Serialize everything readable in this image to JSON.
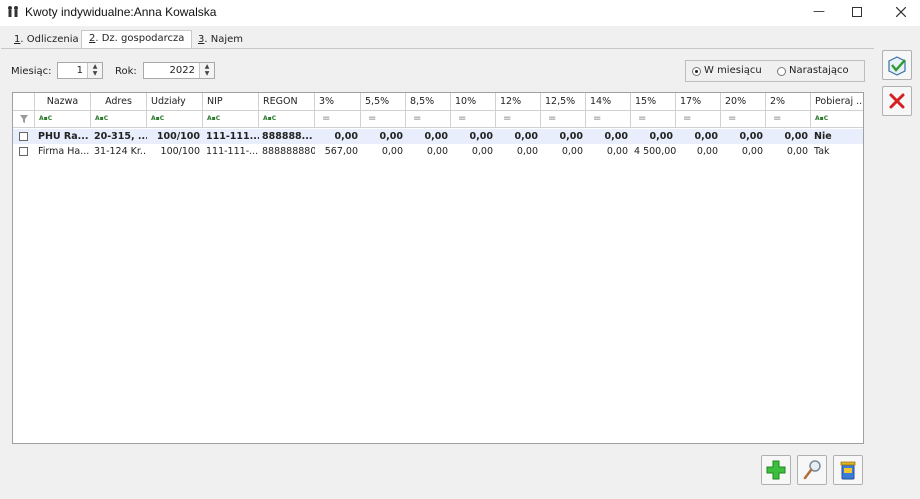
{
  "window": {
    "title": "Kwoty indywidualne:Anna Kowalska"
  },
  "tabs": [
    {
      "key": "1",
      "label": ". Odliczenia"
    },
    {
      "key": "2",
      "label": ". Dz. gospodarcza"
    },
    {
      "key": "3",
      "label": ". Najem"
    }
  ],
  "filters": {
    "month_label": "Miesiąc:",
    "month_value": "1",
    "year_label": "Rok:",
    "year_value": "2022",
    "radio_monthly": "W miesiącu",
    "radio_cumulative": "Narastająco"
  },
  "table": {
    "columns": [
      "Nazwa",
      "Adres",
      "Udziały",
      "NIP",
      "REGON",
      "3%",
      "5,5%",
      "8,5%",
      "10%",
      "12%",
      "12,5%",
      "14%",
      "15%",
      "17%",
      "20%",
      "2%",
      "Pobieraj ..."
    ],
    "rows": [
      [
        "PHU Ra...",
        "20-315, ...",
        "100/100",
        "111-111...",
        "888888...",
        "0,00",
        "0,00",
        "0,00",
        "0,00",
        "0,00",
        "0,00",
        "0,00",
        "0,00",
        "0,00",
        "0,00",
        "0,00",
        "Nie"
      ],
      [
        "Firma Ha...",
        "31-124 Kr...",
        "100/100",
        "111-111-...",
        "888888880",
        "567,00",
        "0,00",
        "0,00",
        "0,00",
        "0,00",
        "0,00",
        "0,00",
        "4 500,00",
        "0,00",
        "0,00",
        "0,00",
        "Tak"
      ]
    ]
  },
  "icons": {
    "title": "people-icon",
    "save": "save-checkmark-icon",
    "cancel": "cancel-x-icon",
    "add": "add-plus-icon",
    "edit": "magnifier-icon",
    "delete": "trash-bin-icon"
  }
}
